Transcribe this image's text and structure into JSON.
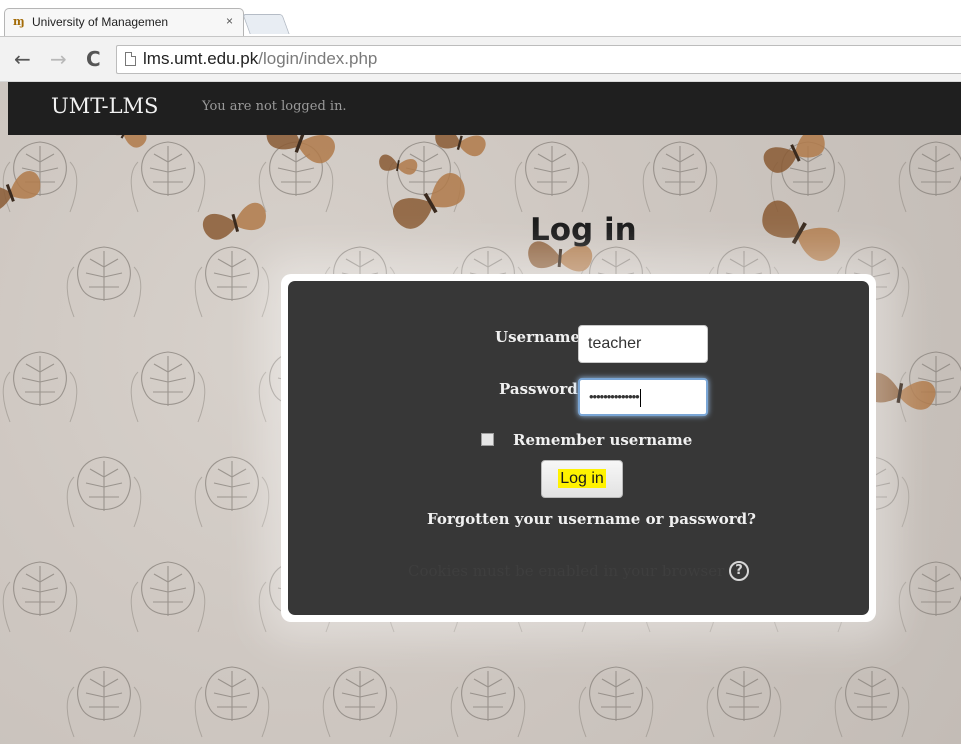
{
  "browser": {
    "tab": {
      "icon_glyph": "ɱ",
      "icon_name": "umt-favicon-icon",
      "title": "University of Managemen",
      "close_glyph": "×"
    },
    "nav": {
      "back_glyph": "←",
      "forward_glyph": "→",
      "reload_glyph": "C"
    },
    "url": {
      "host": "lms.umt.edu.pk",
      "path": "/login/index.php"
    }
  },
  "navbar": {
    "brand": "UMT-LMS",
    "status": "You are not logged in."
  },
  "login": {
    "heading": "Log in",
    "username_label": "Username",
    "username_value": "teacher",
    "password_label": "Password",
    "password_masked": "••••••••••••••",
    "remember_label": "Remember username",
    "remember_checked": false,
    "submit_label": "Log in",
    "forgot_link": "Forgotten your username or password?",
    "cookie_notice": "Cookies must be enabled in your browser",
    "help_glyph": "?"
  },
  "colors": {
    "navbar_bg": "#1f1f1f",
    "panel_bg": "#161616",
    "button_highlight": "#fff200",
    "focus_ring": "#7aa6d6"
  }
}
